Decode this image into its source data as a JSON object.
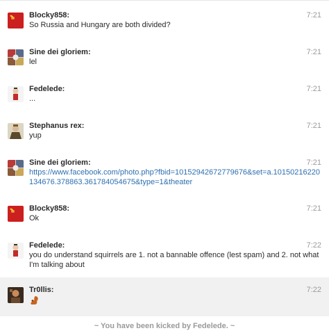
{
  "messages": [
    {
      "author": "Blocky858:",
      "time": "7:21",
      "text": "So Russia and Hungary are both divided?",
      "avatar": "soviet-flag-icon"
    },
    {
      "author": "Sine dei gloriem:",
      "time": "7:21",
      "text": "lel",
      "avatar": "avatar-sine"
    },
    {
      "author": "Fedelede:",
      "time": "7:21",
      "text": "...",
      "avatar": "avatar-fedelede"
    },
    {
      "author": "Stephanus rex:",
      "time": "7:21",
      "text": "yup",
      "avatar": "avatar-stephanus"
    },
    {
      "author": "Sine dei gloriem:",
      "time": "7:21",
      "link": "https://www.facebook.com/photo.php?fbid=10152942672779676&set=a.10150216220134676.378863.361784054675&type=1&theater",
      "avatar": "avatar-sine"
    },
    {
      "author": "Blocky858:",
      "time": "7:21",
      "text": "Ok",
      "avatar": "soviet-flag-icon"
    },
    {
      "author": "Fedelede:",
      "time": "7:22",
      "text": "you do understand squirrels are 1. not a bannable offence (lest spam) and 2. not what I'm talking about",
      "avatar": "avatar-fedelede"
    },
    {
      "author": "Tr0llis:",
      "time": "7:22",
      "emoji": "squirrel-emoji",
      "avatar": "avatar-trollis"
    }
  ],
  "system_message": "~ You have been kicked by Fedelede. ~",
  "colors": {
    "link": "#2d6fb0",
    "time": "#9a9a9a",
    "highlight_row": "#f1f1f1"
  }
}
